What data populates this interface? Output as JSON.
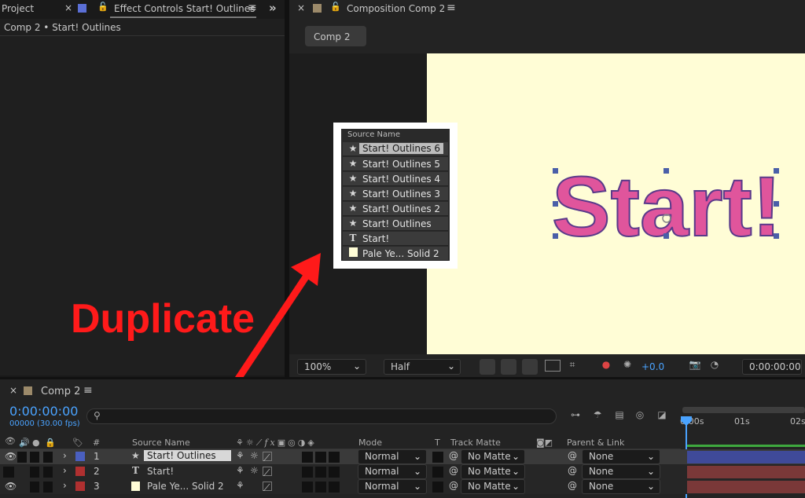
{
  "project_panel": {
    "tab_project": "Project",
    "tab_effect_controls": "Effect Controls Start! Outlines",
    "breadcrumb": "Comp 2 • Start! Outlines"
  },
  "comp_panel": {
    "tab_title": "Composition Comp 2",
    "comp_tab": "Comp 2",
    "zoom": "100%",
    "resolution": "Half",
    "exposure": "+0.0",
    "timecode": "0:00:00:00",
    "canvas_text": "Start!",
    "canvas_bg": "#fffdd6",
    "text_color": "#e0559c"
  },
  "popup": {
    "header": "Source Name",
    "items": [
      {
        "icon": "star",
        "label": "Start! Outlines 6",
        "selected": true
      },
      {
        "icon": "star",
        "label": "Start! Outlines 5"
      },
      {
        "icon": "star",
        "label": "Start! Outlines 4"
      },
      {
        "icon": "star",
        "label": "Start! Outlines 3"
      },
      {
        "icon": "star",
        "label": "Start! Outlines 2"
      },
      {
        "icon": "star",
        "label": "Start! Outlines"
      },
      {
        "icon": "text",
        "label": "Start!"
      },
      {
        "icon": "solid",
        "label": "Pale Ye... Solid 2"
      }
    ]
  },
  "annotation": {
    "label": "Duplicate",
    "color": "#ff1a1a"
  },
  "timeline": {
    "tab_title": "Comp 2",
    "timecode": "0:00:00:00",
    "frames": "00000 (30.00 fps)",
    "search_placeholder": "",
    "headers": {
      "num": "#",
      "source_name": "Source Name",
      "mode": "Mode",
      "t": "T",
      "track_matte": "Track Matte",
      "parent_link": "Parent & Link"
    },
    "ruler": [
      "0:00s",
      "01s",
      "02s"
    ],
    "layers": [
      {
        "num": "1",
        "icon": "star",
        "name": "Start! Outlines",
        "color": "#4a5fbf",
        "mode": "Normal",
        "matte": "No Matte",
        "parent": "None",
        "bar": "#3f4a99"
      },
      {
        "num": "2",
        "icon": "text",
        "name": "Start!",
        "color": "#b03030",
        "mode": "Normal",
        "matte": "No Matte",
        "parent": "None",
        "bar": "#7a3838"
      },
      {
        "num": "3",
        "icon": "solid",
        "name": "Pale Ye... Solid 2",
        "color": "#b03030",
        "mode": "Normal",
        "matte": "No Matte",
        "parent": "None",
        "bar": "#7a3838"
      }
    ]
  }
}
